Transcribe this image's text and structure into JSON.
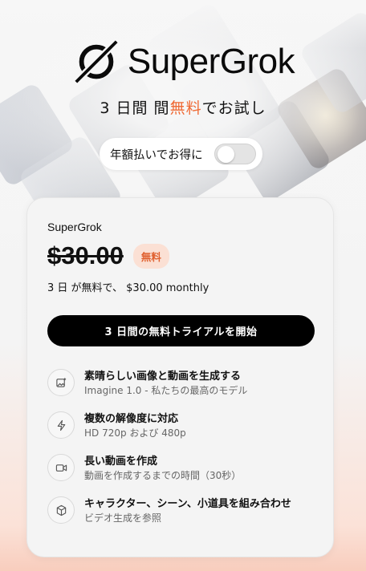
{
  "header": {
    "brand": "SuperGrok",
    "trial_prefix": "3 日間 間",
    "trial_accent": "無料",
    "trial_suffix": "でお試し",
    "annual_toggle_label": "年額払いでお得に",
    "annual_toggle_on": false
  },
  "plan": {
    "name": "SuperGrok",
    "old_price": "$30.00",
    "badge": "無料",
    "price_note": "3 日 が無料で、 $30.00 monthly",
    "cta_label": "3 日間の無料トライアルを開始"
  },
  "features": [
    {
      "icon": "image-sparkle-icon",
      "title": "素晴らしい画像と動画を生成する",
      "subtitle": "Imagine 1.0 - 私たちの最高のモデル"
    },
    {
      "icon": "lightning-icon",
      "title": "複数の解像度に対応",
      "subtitle": "HD 720p および 480p"
    },
    {
      "icon": "video-camera-icon",
      "title": "長い動画を作成",
      "subtitle": "動画を作成するまでの時間（30秒）"
    },
    {
      "icon": "cube-icon",
      "title": "キャラクター、シーン、小道具を組み合わせ",
      "subtitle": "ビデオ生成を参照"
    }
  ],
  "colors": {
    "accent": "#ef6a35",
    "badge_bg": "#fbe0d4",
    "cta_bg": "#000000"
  }
}
